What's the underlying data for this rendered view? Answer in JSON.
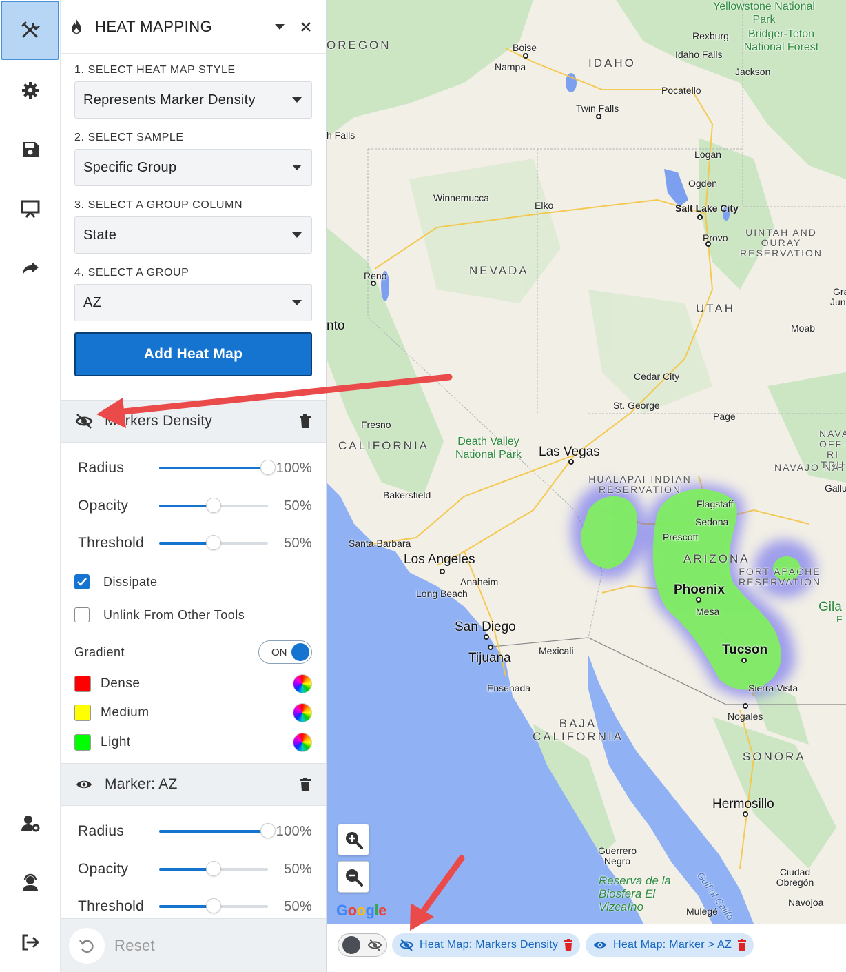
{
  "panel": {
    "title": "HEAT MAPPING",
    "steps": [
      {
        "label": "1. SELECT HEAT MAP STYLE",
        "value": "Represents Marker Density"
      },
      {
        "label": "2. SELECT SAMPLE",
        "value": "Specific Group"
      },
      {
        "label": "3. SELECT A GROUP COLUMN",
        "value": "State"
      },
      {
        "label": "4. SELECT A GROUP",
        "value": "AZ"
      }
    ],
    "add_button": "Add Heat Map",
    "layers": [
      {
        "name": "Markers Density",
        "visible": false,
        "sliders": [
          {
            "label": "Radius",
            "value": "100%",
            "fraction": 1.0
          },
          {
            "label": "Opacity",
            "value": "50%",
            "fraction": 0.5
          },
          {
            "label": "Threshold",
            "value": "50%",
            "fraction": 0.5
          }
        ],
        "dissipate_label": "Dissipate",
        "dissipate_checked": true,
        "unlink_label": "Unlink From Other Tools",
        "unlink_checked": false,
        "gradient_label": "Gradient",
        "gradient_toggle": "ON",
        "colors": [
          {
            "name": "Dense",
            "color": "#ff0000"
          },
          {
            "name": "Medium",
            "color": "#ffff00"
          },
          {
            "name": "Light",
            "color": "#00ff00"
          }
        ]
      },
      {
        "name": "Marker: AZ",
        "visible": true,
        "sliders": [
          {
            "label": "Radius",
            "value": "100%",
            "fraction": 1.0
          },
          {
            "label": "Opacity",
            "value": "50%",
            "fraction": 0.5
          },
          {
            "label": "Threshold",
            "value": "50%",
            "fraction": 0.5
          }
        ]
      }
    ],
    "reset_label": "Reset"
  },
  "map": {
    "states": [
      "OREGON",
      "IDAHO",
      "NEVADA",
      "UTAH",
      "CALIFORNIA",
      "ARIZONA",
      "SONORA",
      "BAJA CALIFORNIA"
    ],
    "cities": {
      "boise": "Boise",
      "nampa": "Nampa",
      "twin_falls": "Twin Falls",
      "pocatello": "Pocatello",
      "idaho_falls": "Idaho Falls",
      "rexburg": "Rexburg",
      "jackson": "Jackson",
      "logan": "Logan",
      "ogden": "Ogden",
      "slc": "Salt Lake City",
      "provo": "Provo",
      "elko": "Elko",
      "winnemucca": "Winnemucca",
      "reno": "Reno",
      "moab": "Moab",
      "cedar_city": "Cedar City",
      "st_george": "St. George",
      "page": "Page",
      "las_vegas": "Las Vegas",
      "fresno": "Fresno",
      "bakersfield": "Bakersfield",
      "santa_barbara": "Santa Barbara",
      "los_angeles": "Los Angeles",
      "anaheim": "Anaheim",
      "long_beach": "Long Beach",
      "san_diego": "San Diego",
      "tijuana": "Tijuana",
      "mexicali": "Mexicali",
      "ensenada": "Ensenada",
      "flagstaff": "Flagstaff",
      "sedona": "Sedona",
      "prescott": "Prescott",
      "phoenix": "Phoenix",
      "mesa": "Mesa",
      "tucson": "Tucson",
      "sierra_vista": "Sierra Vista",
      "nogales": "Nogales",
      "hermosillo": "Hermosillo",
      "guerrero_negro": "Guerrero Negro",
      "ciudad_obregon": "Ciudad Obregón",
      "navojoa": "Navojoa",
      "mulege": "Mulegé",
      "gallup": "Gallu",
      "falls": "h Falls",
      "nto": "nto",
      "gila": "Gila",
      "gila2": "F",
      "gra": "Gra",
      "jun": "Jun"
    },
    "parks": {
      "yellowstone": "Yellowstone National Park",
      "bridger": "Bridger-Teton National Forest",
      "death_valley": "Death Valley National Park",
      "vizcaino": "Reserva de la Biosfera El Vizcaíno"
    },
    "reservations": {
      "uintah": "UINTAH AND OURAY RESERVATION",
      "hualapai": "HUALAPAI INDIAN RESERVATION",
      "fort_apache": "FORT APACHE RESERVATION",
      "navajo": "NAVAJO NAT",
      "nava_off": "NAVA OFF-RI TRU"
    },
    "water": {
      "gulf": "Gulf of Califo"
    },
    "attribution": "Google"
  },
  "bottom_bar": {
    "chips": [
      {
        "label": "Heat Map: Markers Density",
        "visible": false
      },
      {
        "label": "Heat Map: Marker > AZ",
        "visible": true
      }
    ]
  },
  "colors": {
    "accent": "#1574cf",
    "heat": "#7ef25a",
    "heat_edge": "#5b5bf0"
  }
}
